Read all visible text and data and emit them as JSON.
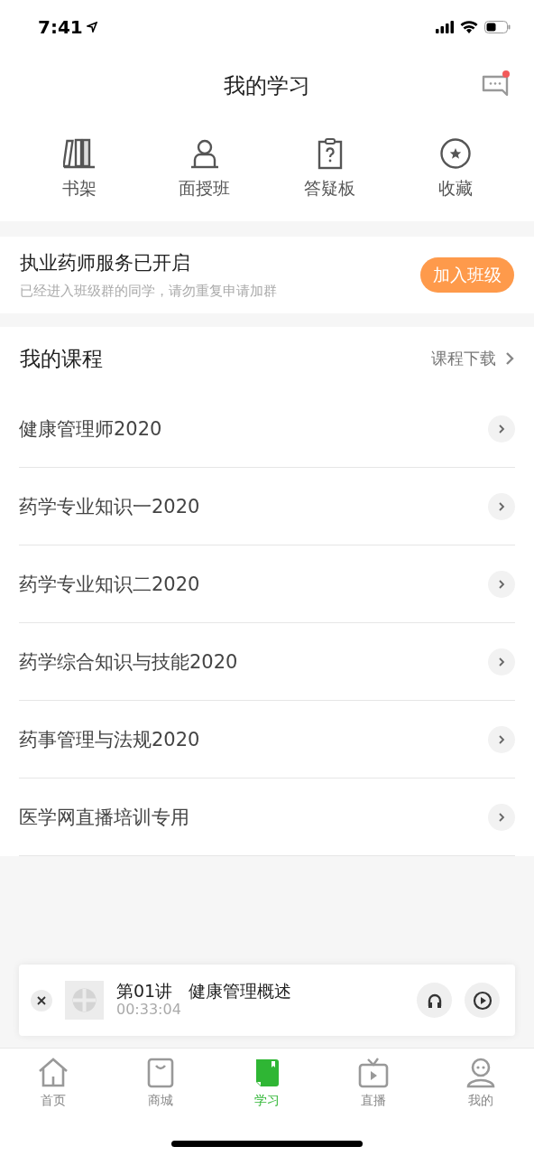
{
  "status_bar": {
    "time": "7:41"
  },
  "header": {
    "title": "我的学习",
    "messages": {
      "unread": true
    }
  },
  "quick_links": [
    {
      "label": "书架",
      "kind": "shelf"
    },
    {
      "label": "面授班",
      "kind": "class"
    },
    {
      "label": "答疑板",
      "kind": "qa"
    },
    {
      "label": "收藏",
      "kind": "favorite"
    }
  ],
  "notice": {
    "title": "执业药师服务已开启",
    "subtitle": "已经进入班级群的同学，请勿重复申请加群",
    "button": "加入班级"
  },
  "courses": {
    "title": "我的课程",
    "download": "课程下载",
    "items": [
      {
        "name": "健康管理师2020"
      },
      {
        "name": "药学专业知识一2020"
      },
      {
        "name": "药学专业知识二2020"
      },
      {
        "name": "药学综合知识与技能2020"
      },
      {
        "name": "药事管理与法规2020"
      },
      {
        "name": "医学网直播培训专用"
      }
    ]
  },
  "player": {
    "lecture": "第01讲",
    "title": "健康管理概述",
    "time": "00:33:04"
  },
  "tab_bar": {
    "items": [
      {
        "label": "首页",
        "kind": "home",
        "selected": false
      },
      {
        "label": "商城",
        "kind": "shop",
        "selected": false
      },
      {
        "label": "学习",
        "kind": "study",
        "selected": true
      },
      {
        "label": "直播",
        "kind": "live",
        "selected": false
      },
      {
        "label": "我的",
        "kind": "me",
        "selected": false
      }
    ]
  }
}
